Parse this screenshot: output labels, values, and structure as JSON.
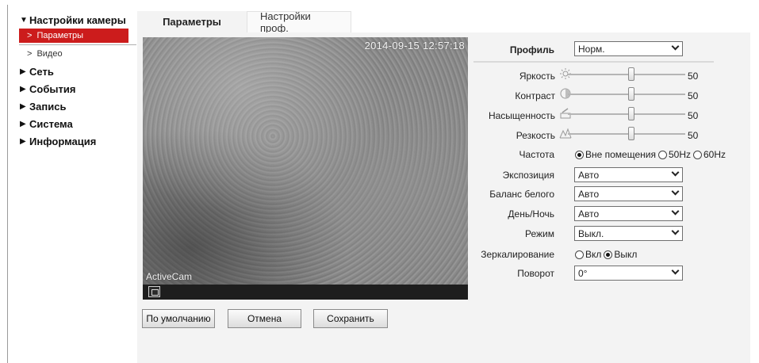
{
  "sidebar": {
    "camera_settings": "Настройки камеры",
    "params": "Параметры",
    "video": "Видео",
    "network": "Сеть",
    "events": "События",
    "record": "Запись",
    "system": "Система",
    "info": "Информация"
  },
  "tabs": {
    "params": "Параметры",
    "pro": "Настройки проф."
  },
  "video": {
    "timestamp": "2014-09-15 12:57:18",
    "brand": "ActiveCam"
  },
  "buttons": {
    "default": "По умолчанию",
    "cancel": "Отмена",
    "save": "Сохранить"
  },
  "form": {
    "profile_label": "Профиль",
    "profile_value": "Норм.",
    "brightness_label": "Яркость",
    "brightness_value": "50",
    "contrast_label": "Контраст",
    "contrast_value": "50",
    "saturation_label": "Насыщенность",
    "saturation_value": "50",
    "sharpness_label": "Резкость",
    "sharpness_value": "50",
    "frequency_label": "Частота",
    "freq_outdoor": "Вне помещения",
    "freq_50": "50Hz",
    "freq_60": "60Hz",
    "exposure_label": "Экспозиция",
    "exposure_value": "Авто",
    "wb_label": "Баланс белого",
    "wb_value": "Авто",
    "daynight_label": "День/Ночь",
    "daynight_value": "Авто",
    "mode_label": "Режим",
    "mode_value": "Выкл.",
    "mirror_label": "Зеркалирование",
    "mirror_on": "Вкл",
    "mirror_off": "Выкл",
    "rotate_label": "Поворот",
    "rotate_value": "0°"
  },
  "colors": {
    "accent": "#cc1c1c",
    "panel": "#f3f3f3"
  }
}
